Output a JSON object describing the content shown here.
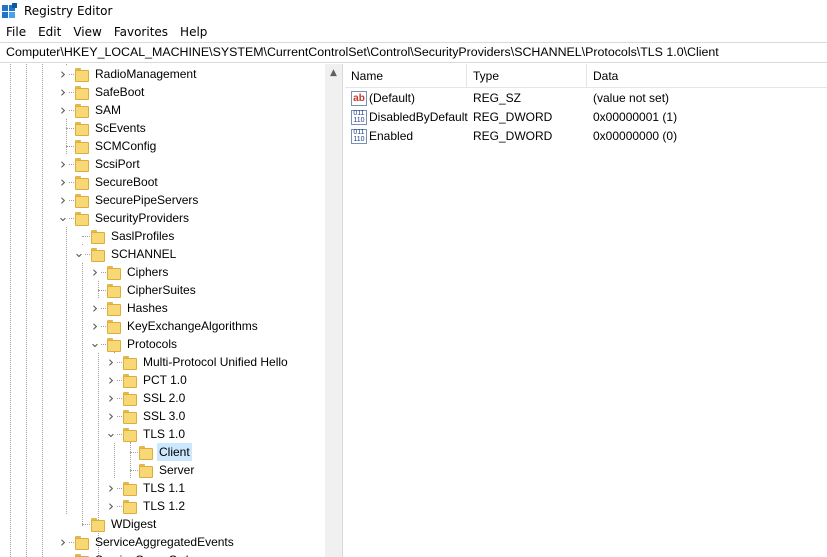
{
  "window": {
    "title": "Registry Editor",
    "icon": "registry-editor-icon"
  },
  "menu": [
    "File",
    "Edit",
    "View",
    "Favorites",
    "Help"
  ],
  "address": "Computer\\HKEY_LOCAL_MACHINE\\SYSTEM\\CurrentControlSet\\Control\\SecurityProviders\\SCHANNEL\\Protocols\\TLS 1.0\\Client",
  "tree": {
    "nodes": [
      {
        "label": "RadioManagement",
        "expander": "›"
      },
      {
        "label": "SafeBoot",
        "expander": "›"
      },
      {
        "label": "SAM",
        "expander": "›"
      },
      {
        "label": "ScEvents",
        "expander": ""
      },
      {
        "label": "SCMConfig",
        "expander": ""
      },
      {
        "label": "ScsiPort",
        "expander": "›"
      },
      {
        "label": "SecureBoot",
        "expander": "›"
      },
      {
        "label": "SecurePipeServers",
        "expander": "›"
      },
      {
        "label": "SecurityProviders",
        "expander": "⌄"
      },
      {
        "label": "SaslProfiles",
        "expander": ""
      },
      {
        "label": "SCHANNEL",
        "expander": "⌄"
      },
      {
        "label": "Ciphers",
        "expander": "›"
      },
      {
        "label": "CipherSuites",
        "expander": ""
      },
      {
        "label": "Hashes",
        "expander": "›"
      },
      {
        "label": "KeyExchangeAlgorithms",
        "expander": "›"
      },
      {
        "label": "Protocols",
        "expander": "⌄"
      },
      {
        "label": "Multi-Protocol Unified Hello",
        "expander": "›"
      },
      {
        "label": "PCT 1.0",
        "expander": "›"
      },
      {
        "label": "SSL 2.0",
        "expander": "›"
      },
      {
        "label": "SSL 3.0",
        "expander": "›"
      },
      {
        "label": "TLS 1.0",
        "expander": "⌄"
      },
      {
        "label": "Client",
        "expander": "",
        "selected": true
      },
      {
        "label": "Server",
        "expander": ""
      },
      {
        "label": "TLS 1.1",
        "expander": "›"
      },
      {
        "label": "TLS 1.2",
        "expander": "›"
      },
      {
        "label": "WDigest",
        "expander": ""
      },
      {
        "label": "ServiceAggregatedEvents",
        "expander": "›"
      },
      {
        "label": "ServiceGroupOrder",
        "expander": "›"
      }
    ]
  },
  "list": {
    "columns": [
      "Name",
      "Type",
      "Data"
    ],
    "rows": [
      {
        "icon": "string-value-icon",
        "icon_text": "ab",
        "name": "(Default)",
        "type": "REG_SZ",
        "data": "(value not set)"
      },
      {
        "icon": "dword-value-icon",
        "icon_text": "011 110",
        "name": "DisabledByDefault",
        "type": "REG_DWORD",
        "data": "0x00000001 (1)"
      },
      {
        "icon": "dword-value-icon",
        "icon_text": "011 110",
        "name": "Enabled",
        "type": "REG_DWORD",
        "data": "0x00000000 (0)"
      }
    ]
  },
  "colors": {
    "selection": "#cce8ff",
    "folder": "#f8d775",
    "border": "#d9d9d9"
  }
}
